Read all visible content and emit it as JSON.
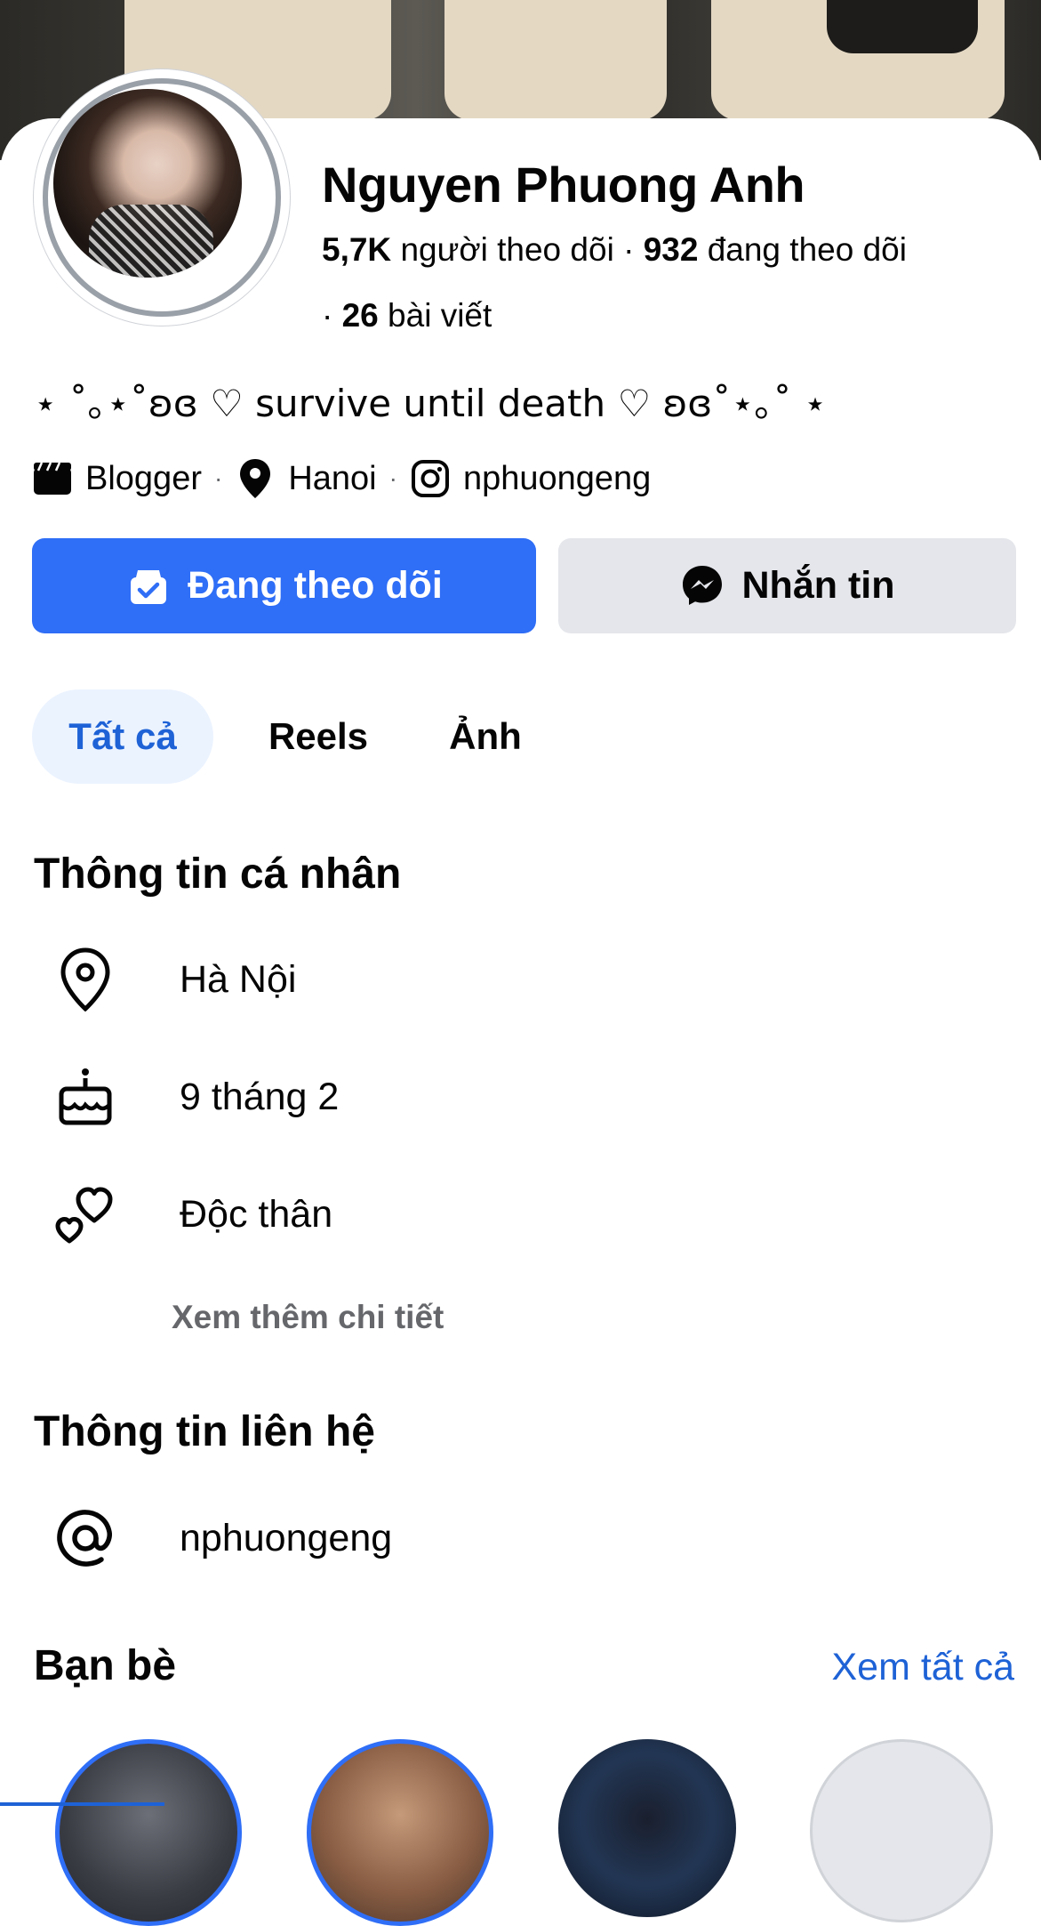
{
  "profile": {
    "name": "Nguyen Phuong Anh",
    "followers_count": "5,7K",
    "followers_label": "người theo dõi",
    "following_count": "932",
    "following_label": "đang theo dõi",
    "posts_count": "26",
    "posts_label": "bài viết",
    "bio": "⋆ ˚｡⋆˚ʚɞ ♡ survive until death ♡ ʚɞ˚⋆｡˚ ⋆",
    "category": "Blogger",
    "location_short": "Hanoi",
    "instagram": "nphuongeng"
  },
  "actions": {
    "follow_label": "Đang theo dõi",
    "message_label": "Nhắn tin"
  },
  "tabs": [
    {
      "label": "Tất cả",
      "active": true
    },
    {
      "label": "Reels",
      "active": false
    },
    {
      "label": "Ảnh",
      "active": false
    }
  ],
  "personal_info": {
    "title": "Thông tin cá nhân",
    "items": [
      {
        "icon": "location-pin-icon",
        "text": "Hà Nội"
      },
      {
        "icon": "birthday-cake-icon",
        "text": "9 tháng 2"
      },
      {
        "icon": "hearts-icon",
        "text": "Độc thân"
      }
    ],
    "more_label": "Xem thêm chi tiết"
  },
  "contact_info": {
    "title": "Thông tin liên hệ",
    "items": [
      {
        "icon": "at-sign-icon",
        "text": "nphuongeng"
      }
    ]
  },
  "friends": {
    "title": "Bạn bè",
    "see_all_label": "Xem tất cả"
  },
  "colors": {
    "accent": "#2f6ef6",
    "link": "#1e62d6",
    "active_tab_bg": "#ebf3ff",
    "secondary_button": "#e4e6eb",
    "muted_text": "#65676b"
  }
}
